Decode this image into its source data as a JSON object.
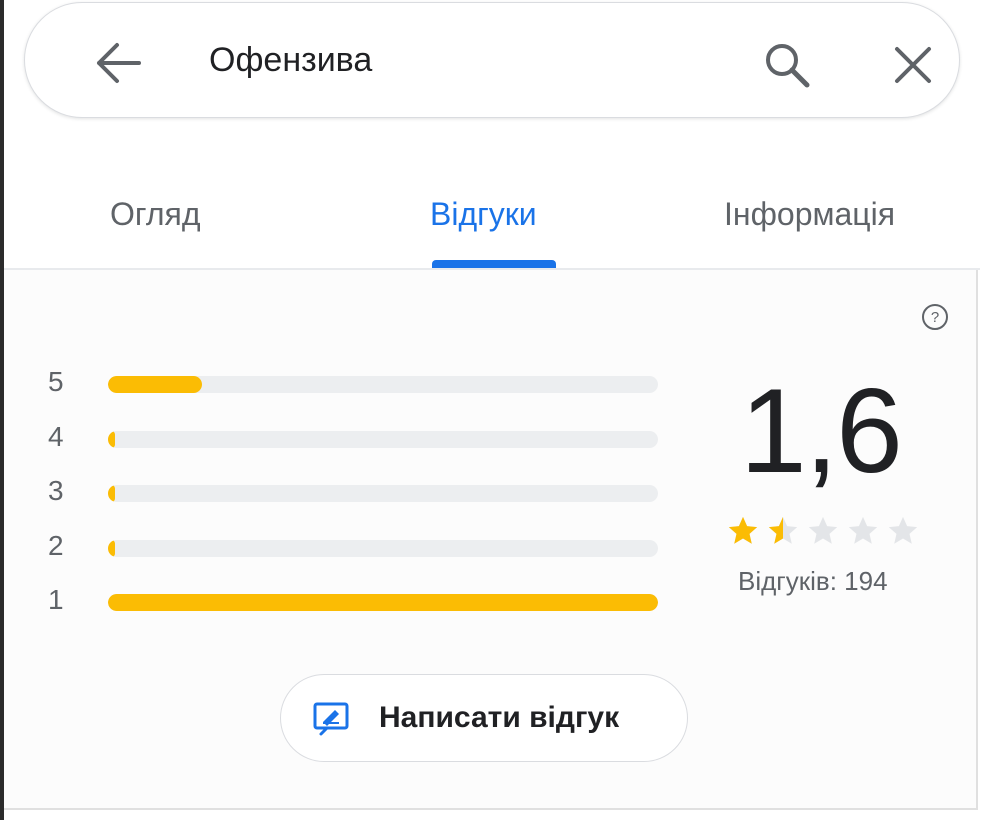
{
  "search": {
    "query": "Офензива"
  },
  "tabs": [
    {
      "label": "Огляд",
      "active": false
    },
    {
      "label": "Відгуки",
      "active": true
    },
    {
      "label": "Інформація",
      "active": false
    }
  ],
  "ratings": {
    "rows": [
      {
        "stars": "5",
        "fraction": 0.17
      },
      {
        "stars": "4",
        "fraction": 0.01
      },
      {
        "stars": "3",
        "fraction": 0.01
      },
      {
        "stars": "2",
        "fraction": 0.005
      },
      {
        "stars": "1",
        "fraction": 1.0
      }
    ],
    "average": "1,6",
    "stars_filled": 1.5,
    "reviews_count_text": "Відгуків: 194"
  },
  "actions": {
    "write_review": "Написати відгук"
  },
  "colors": {
    "accent": "#1a73e8",
    "star": "#fbbc04",
    "track": "#eceef0"
  }
}
